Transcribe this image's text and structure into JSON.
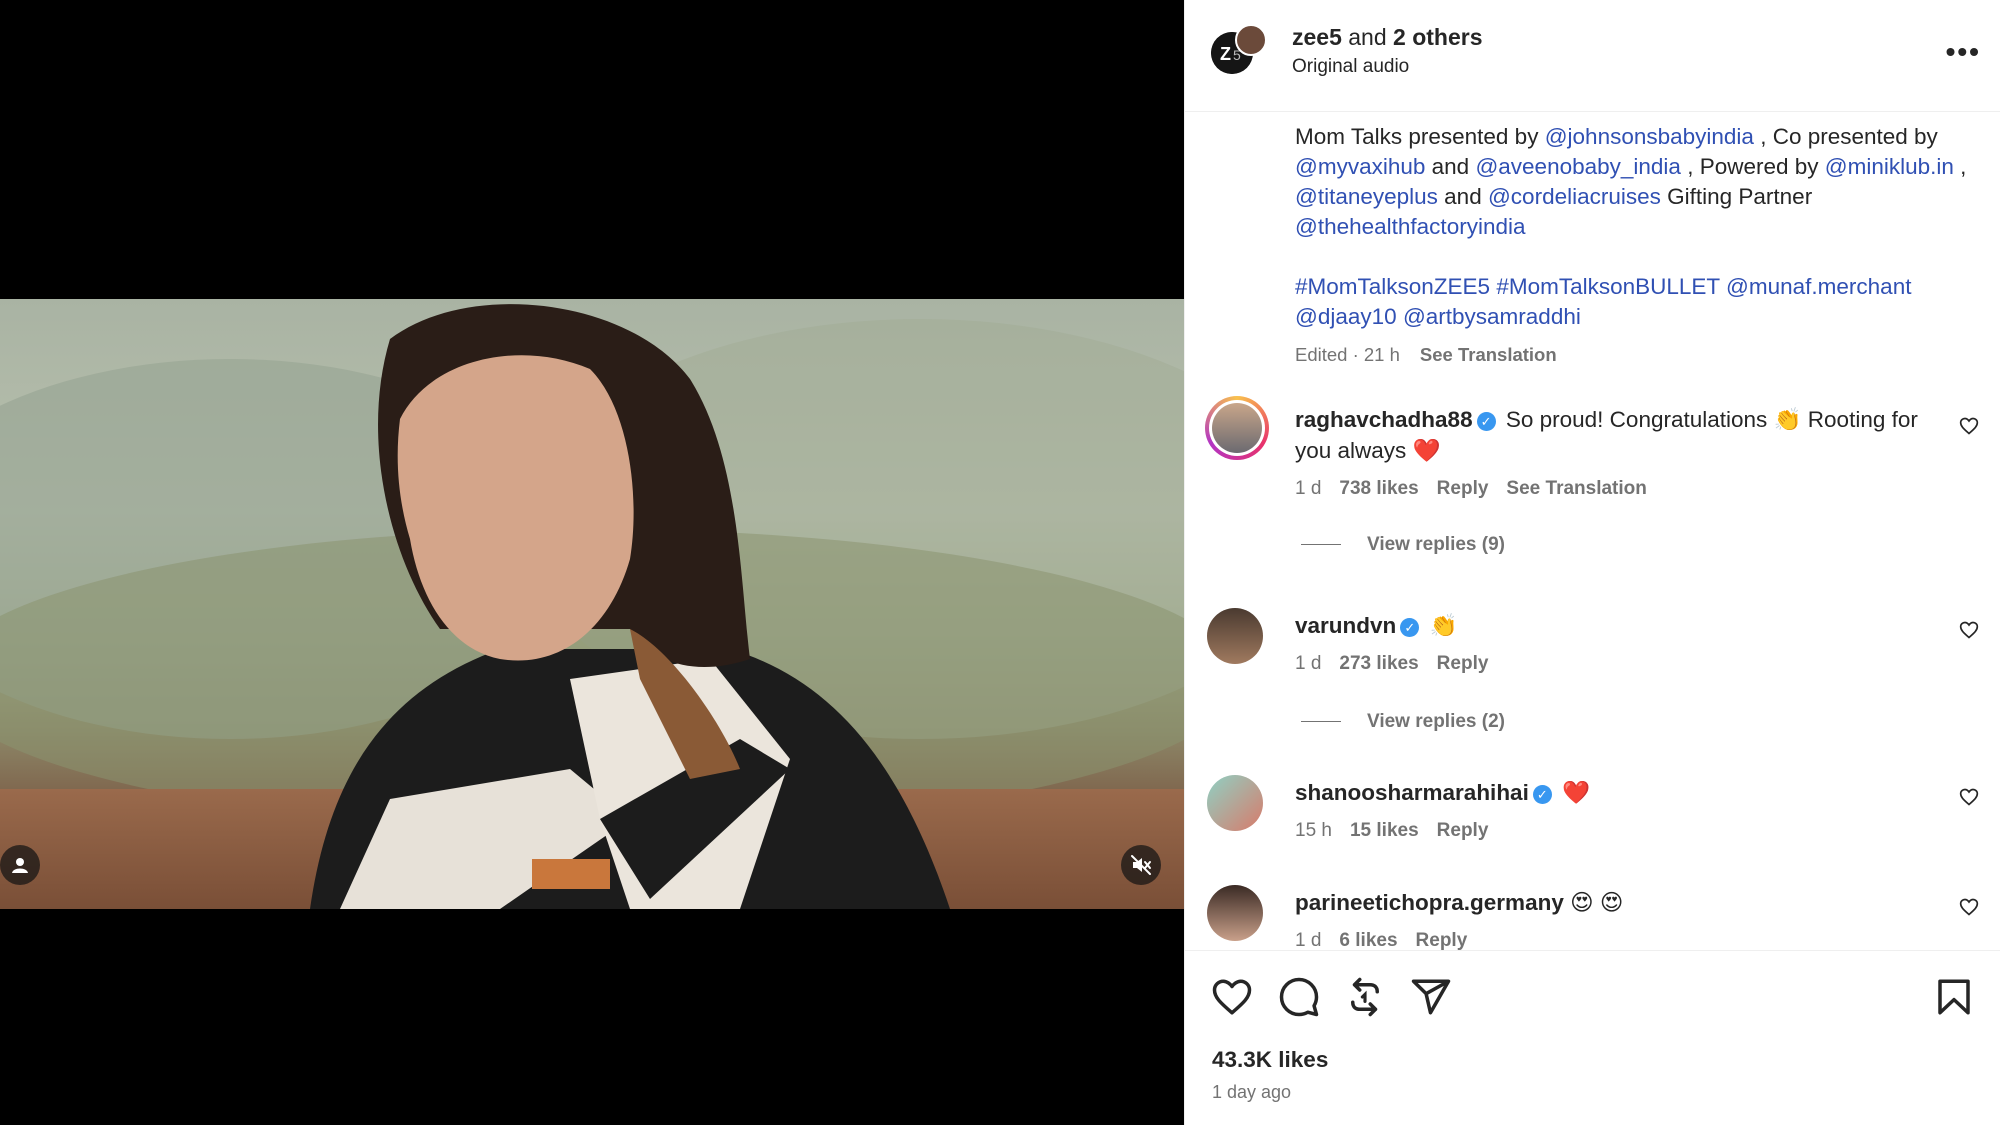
{
  "header": {
    "author": "zee5",
    "joiner": " and ",
    "others": "2 others",
    "audio": "Original audio",
    "more_label": "•••"
  },
  "caption": {
    "t1": "Mom Talks presented by ",
    "m1": "@johnsonsbabyindia",
    "t2": " , Co presented by ",
    "m2": "@myvaxihub",
    "t3": " and ",
    "m3": "@aveenobaby_india",
    "t4": " , Powered by ",
    "m4": "@miniklub.in",
    "t5": " , ",
    "m5": "@titaneyeplus",
    "t6": " and ",
    "m6": "@cordeliacruises",
    "t7": " Gifting Partner ",
    "m7": "@thehealthfactoryindia",
    "h1": "#MomTalksonZEE5",
    "h2": "#MomTalksonBULLET",
    "m8": "@munaf.merchant",
    "m9": "@djaay10",
    "m10": "@artbysamraddhi",
    "edited": "Edited · 21 h",
    "see_translation": "See Translation"
  },
  "comments": [
    {
      "user": "raghavchadha88",
      "text": "So proud! Congratulations 👏 Rooting for you always ❤️",
      "time": "1 d",
      "likes": "738 likes",
      "reply": "Reply",
      "translation": "See Translation",
      "view_replies": "View replies (9)"
    },
    {
      "user": "varundvn",
      "text": "👏",
      "time": "1 d",
      "likes": "273 likes",
      "reply": "Reply",
      "view_replies": "View replies (2)"
    },
    {
      "user": "shanoosharmarahihai",
      "text": "❤️",
      "time": "15 h",
      "likes": "15 likes",
      "reply": "Reply"
    },
    {
      "user": "parineetichopra.germany",
      "text": "😍 😍",
      "time": "1 d",
      "likes": "6 likes",
      "reply": "Reply"
    }
  ],
  "footer": {
    "likes": "43.3K likes",
    "posted": "1 day ago"
  },
  "colors": {
    "link": "#3050b3",
    "verified": "#3897f0",
    "muted": "#737373",
    "text": "#262626"
  },
  "icons": [
    "user-tag-icon",
    "mute-icon",
    "more-icon",
    "heart-icon",
    "comment-icon",
    "repost-icon",
    "share-icon",
    "bookmark-icon",
    "verified-icon"
  ]
}
